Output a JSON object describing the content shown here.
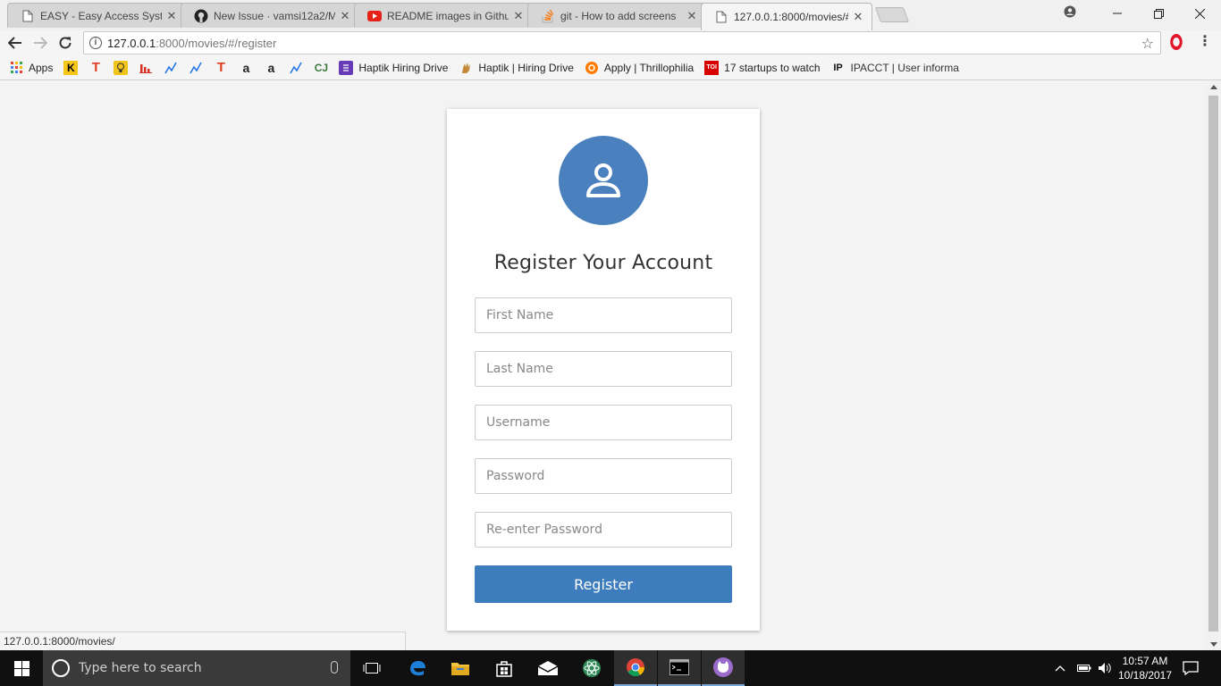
{
  "browser": {
    "tabs": [
      {
        "title": "EASY - Easy Access Syste",
        "icon": "page-icon",
        "active": false
      },
      {
        "title": "New Issue · vamsi12a2/M",
        "icon": "github-icon",
        "active": false
      },
      {
        "title": "README images in Githu",
        "icon": "youtube-icon",
        "active": false
      },
      {
        "title": "git - How to add screens",
        "icon": "stackoverflow-icon",
        "active": false
      },
      {
        "title": "127.0.0.1:8000/movies/#/",
        "icon": "page-icon",
        "active": true
      }
    ],
    "close_glyph": "✕",
    "address": {
      "host": "127.0.0.1",
      "path": ":8000/movies/#/register"
    },
    "bookmarks": [
      {
        "label": "Apps",
        "icon": "apps-grid-icon"
      },
      {
        "label": "",
        "icon": "K",
        "color": "#f5c518"
      },
      {
        "label": "",
        "icon": "T",
        "color": "#e03c1f"
      },
      {
        "label": "",
        "icon": "bulb",
        "color": "#f0c419"
      },
      {
        "label": "",
        "icon": "bars",
        "color": "#d93025"
      },
      {
        "label": "",
        "icon": "trend",
        "color": "#1a73e8"
      },
      {
        "label": "",
        "icon": "trend",
        "color": "#1a73e8"
      },
      {
        "label": "",
        "icon": "T",
        "color": "#e03c1f"
      },
      {
        "label": "",
        "icon": "a",
        "color": "#222222"
      },
      {
        "label": "",
        "icon": "a",
        "color": "#222222"
      },
      {
        "label": "",
        "icon": "trend",
        "color": "#1a73e8"
      },
      {
        "label": "",
        "icon": "CJ",
        "color": "#3b7a3b"
      },
      {
        "label": "Haptik Hiring Drive",
        "icon": "form",
        "color": "#673ab7"
      },
      {
        "label": "Haptik | Hiring Drive",
        "icon": "hand",
        "color": "#c48a3a"
      },
      {
        "label": "Apply | Thrillophilia",
        "icon": "circle",
        "color": "#ff7a00"
      },
      {
        "label": "17 startups to watch",
        "icon": "TOI",
        "color": "#d60000"
      },
      {
        "label": "IPACCT | User informa",
        "icon": "IP",
        "color": "#111111"
      }
    ]
  },
  "page": {
    "title": "Register Your Account",
    "fields": [
      {
        "name": "first-name-input",
        "placeholder": "First Name",
        "type": "text"
      },
      {
        "name": "last-name-input",
        "placeholder": "Last Name",
        "type": "text"
      },
      {
        "name": "username-input",
        "placeholder": "Username",
        "type": "text"
      },
      {
        "name": "password-input",
        "placeholder": "Password",
        "type": "password"
      },
      {
        "name": "reenter-password-input",
        "placeholder": "Re-enter Password",
        "type": "password"
      }
    ],
    "register_label": "Register",
    "accent_color": "#3d7dbd",
    "avatar_color": "#4a80bd"
  },
  "status_bar": {
    "url": "127.0.0.1:8000/movies/"
  },
  "taskbar": {
    "search_placeholder": "Type here to search",
    "time": "10:57 AM",
    "date": "10/18/2017"
  }
}
